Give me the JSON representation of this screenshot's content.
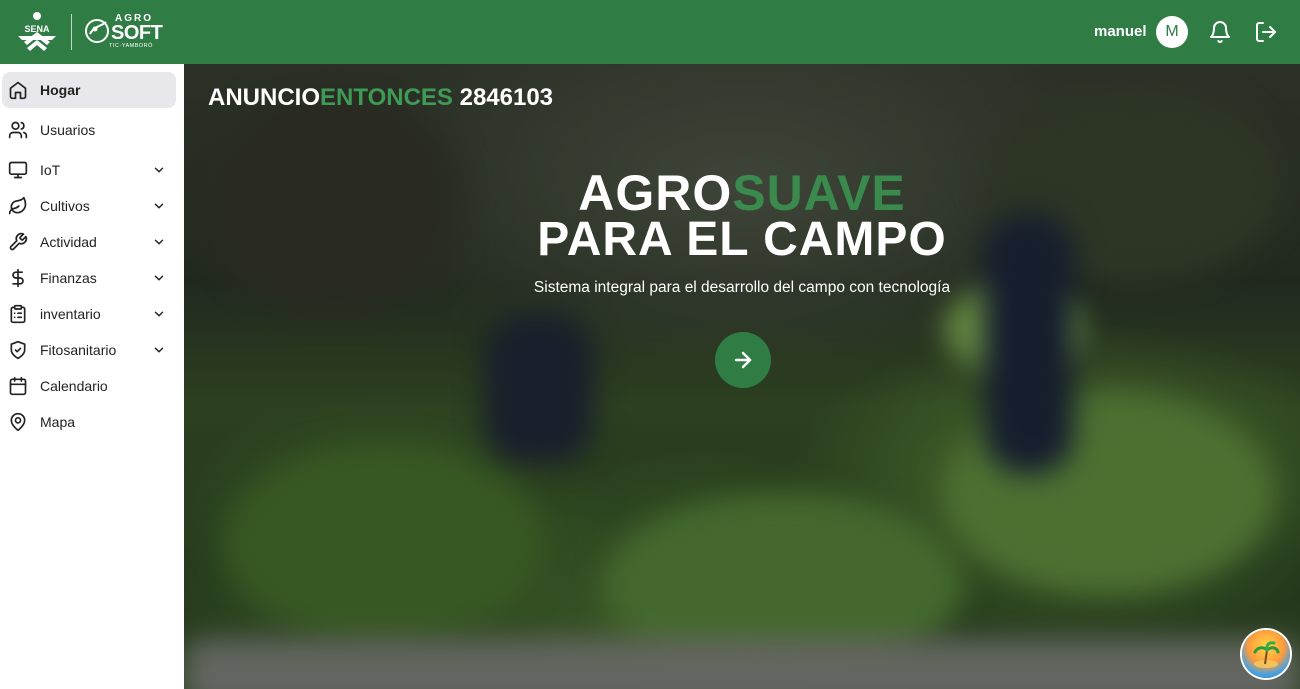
{
  "header": {
    "brand_sena": "SENA",
    "brand_agro": "AGRO",
    "brand_soft": "SOFT",
    "brand_sub": "TIC·YAMBORÓ",
    "user_name": "manuel",
    "avatar_initial": "M",
    "background": "#2f7d44"
  },
  "sidebar": {
    "items": [
      {
        "label": "Hogar",
        "icon": "home-icon",
        "active": true
      },
      {
        "label": "Usuarios",
        "icon": "users-icon"
      },
      {
        "label": "IoT",
        "icon": "monitor-icon",
        "expandable": true
      },
      {
        "label": "Cultivos",
        "icon": "leaf-icon",
        "expandable": true
      },
      {
        "label": "Actividad",
        "icon": "wrench-icon",
        "expandable": true
      },
      {
        "label": "Finanzas",
        "icon": "dollar-icon",
        "expandable": true
      },
      {
        "label": "inventario",
        "icon": "clipboard-icon",
        "expandable": true
      },
      {
        "label": "Fitosanitario",
        "icon": "shield-icon",
        "expandable": true
      },
      {
        "label": "Calendario",
        "icon": "calendar-icon"
      },
      {
        "label": "Mapa",
        "icon": "map-pin-icon"
      }
    ]
  },
  "hero": {
    "counter_label_a": "ANUNCIO",
    "counter_label_b": "ENTONCES",
    "counter_value": "2846103",
    "title_white": "AGRO",
    "title_green": "SUAVE",
    "title_line2": "PARA EL CAMPO",
    "subtitle": "Sistema integral para el desarrollo del campo con tecnología",
    "accent": "#2f7d44"
  }
}
